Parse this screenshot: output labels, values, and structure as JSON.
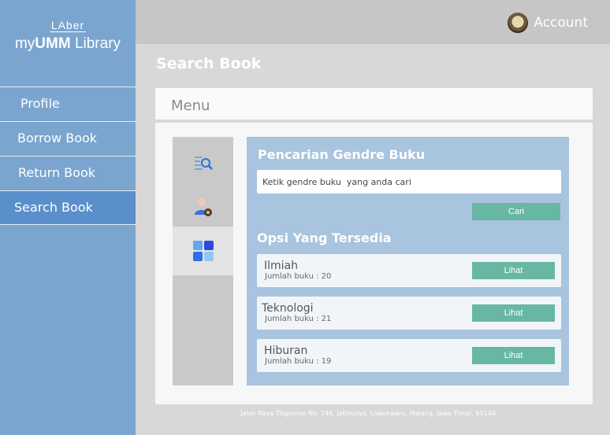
{
  "brand": {
    "small": "LAber",
    "main_prefix": "my",
    "main_bold": "UMM",
    "main_suffix": " Library"
  },
  "sidebar": {
    "items": [
      {
        "label": "Profile"
      },
      {
        "label": "Borrow Book"
      },
      {
        "label": "Return Book"
      },
      {
        "label": "Search Book",
        "active": true
      }
    ]
  },
  "header": {
    "account_label": "Account",
    "avatar_icon": "user-avatar"
  },
  "page": {
    "title": "Search Book"
  },
  "menu": {
    "title": "Menu"
  },
  "tools": [
    {
      "icon": "search-list-icon"
    },
    {
      "icon": "user-search-icon"
    },
    {
      "icon": "grid-icon",
      "active": true
    }
  ],
  "search": {
    "title": "Pencarian Gendre Buku",
    "placeholder": "Ketik gendre buku  yang anda cari",
    "button": "Cari"
  },
  "options": {
    "title": "Opsi Yang Tersedia",
    "items": [
      {
        "name": "Ilmiah",
        "count": "Jumlah buku : 20",
        "button": "Lihat"
      },
      {
        "name": "Teknologi",
        "count": "Jumlah buku : 21",
        "button": "Lihat"
      },
      {
        "name": "Hiburan",
        "count": "Jumlah buku : 19",
        "button": "Lihat"
      }
    ]
  },
  "footer": {
    "address": "Jalan Raya Tlogomas No. 246, Jatimulyo, Lowokwaru, Malang, Jawa Timur, 65144"
  },
  "colors": {
    "sidebar": "#7aa5cf",
    "active_nav": "#5a8fcb",
    "panel": "#a8c4de",
    "button": "#68b7a4"
  }
}
